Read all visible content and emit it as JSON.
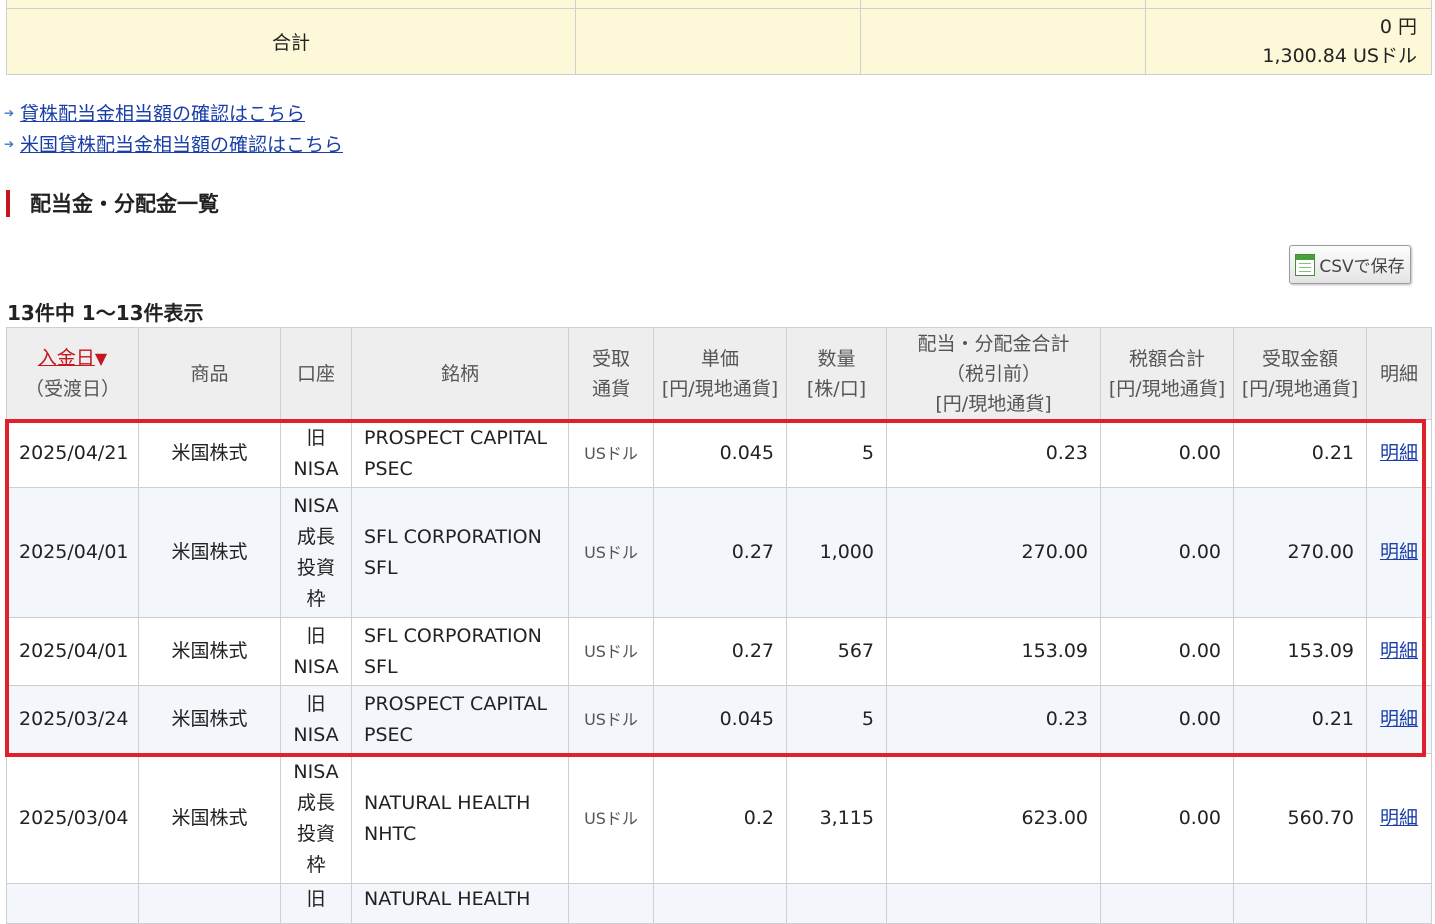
{
  "total": {
    "label": "合計",
    "yen_amount": "0 円",
    "usd_amount": "1,300.84 USドル"
  },
  "links": [
    {
      "arrow": "➔",
      "text": "貸株配当金相当額の確認はこちら"
    },
    {
      "arrow": "➔",
      "text": "米国貸株配当金相当額の確認はこちら"
    }
  ],
  "section_title": "配当金・分配金一覧",
  "csv_button": {
    "label": "CSVで保存",
    "icon": "spreadsheet-icon"
  },
  "count_text": "13件中 1～13件表示",
  "table": {
    "headers": {
      "date": {
        "sort_label": "入金日",
        "sort_icon": "▼",
        "sub": "（受渡日）"
      },
      "product": "商品",
      "account": "口座",
      "issue": "銘柄",
      "currency": [
        "受取",
        "通貨"
      ],
      "unit_price": [
        "単価",
        "[円/現地通貨]"
      ],
      "quantity": [
        "数量",
        "[株/口]"
      ],
      "total_before_tax": [
        "配当・分配金合計",
        "（税引前）",
        "[円/現地通貨]"
      ],
      "tax_total": [
        "税額合計",
        "[円/現地通貨]"
      ],
      "received": [
        "受取金額",
        "[円/現地通貨]"
      ],
      "detail": "明細"
    },
    "rows": [
      {
        "date": "2025/04/21",
        "product": "米国株式",
        "account": [
          "旧",
          "NISA"
        ],
        "issue": [
          "PROSPECT CAPITAL",
          "PSEC"
        ],
        "currency": "USドル",
        "unit_price": "0.045",
        "quantity": "5",
        "total": "0.23",
        "tax": "0.00",
        "received": "0.21",
        "detail": "明細"
      },
      {
        "date": "2025/04/01",
        "product": "米国株式",
        "account": [
          "NISA",
          "成長",
          "投資",
          "枠"
        ],
        "issue": [
          "SFL CORPORATION",
          "SFL"
        ],
        "currency": "USドル",
        "unit_price": "0.27",
        "quantity": "1,000",
        "total": "270.00",
        "tax": "0.00",
        "received": "270.00",
        "detail": "明細"
      },
      {
        "date": "2025/04/01",
        "product": "米国株式",
        "account": [
          "旧",
          "NISA"
        ],
        "issue": [
          "SFL CORPORATION",
          "SFL"
        ],
        "currency": "USドル",
        "unit_price": "0.27",
        "quantity": "567",
        "total": "153.09",
        "tax": "0.00",
        "received": "153.09",
        "detail": "明細"
      },
      {
        "date": "2025/03/24",
        "product": "米国株式",
        "account": [
          "旧",
          "NISA"
        ],
        "issue": [
          "PROSPECT CAPITAL",
          "PSEC"
        ],
        "currency": "USドル",
        "unit_price": "0.045",
        "quantity": "5",
        "total": "0.23",
        "tax": "0.00",
        "received": "0.21",
        "detail": "明細"
      },
      {
        "date": "2025/03/04",
        "product": "米国株式",
        "account": [
          "NISA",
          "成長",
          "投資",
          "枠"
        ],
        "issue": [
          "NATURAL HEALTH",
          "NHTC"
        ],
        "currency": "USドル",
        "unit_price": "0.2",
        "quantity": "3,115",
        "total": "623.00",
        "tax": "0.00",
        "received": "560.70",
        "detail": "明細"
      },
      {
        "date": "",
        "product": "",
        "account": [
          "旧"
        ],
        "issue": [
          "NATURAL HEALTH"
        ],
        "currency": "",
        "unit_price": "",
        "quantity": "",
        "total": "",
        "tax": "",
        "received": "",
        "detail": ""
      }
    ]
  }
}
